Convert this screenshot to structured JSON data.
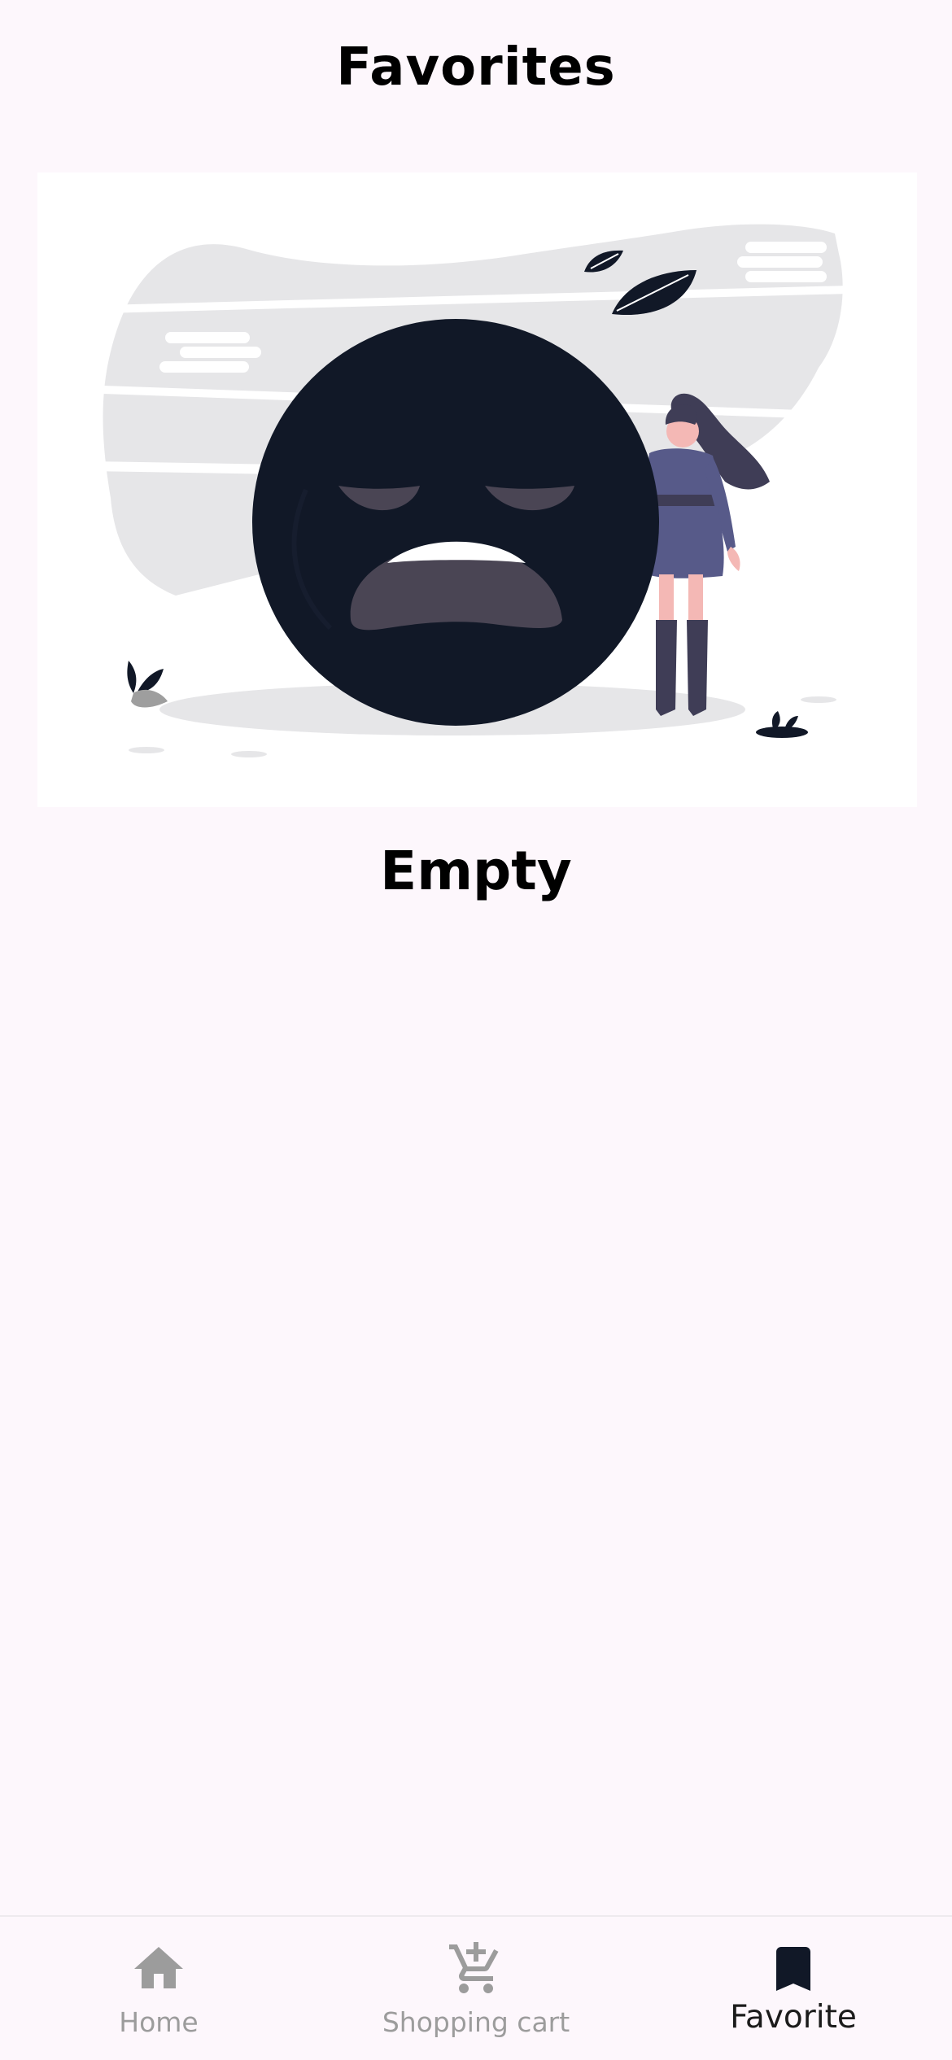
{
  "header": {
    "title": "Favorites"
  },
  "empty_state": {
    "illustration": "sad-face-woman-illustration",
    "message": "Empty"
  },
  "bottom_nav": {
    "items": [
      {
        "label": "Home",
        "icon": "home-icon",
        "active": false
      },
      {
        "label": "Shopping cart",
        "icon": "add-cart-icon",
        "active": false
      },
      {
        "label": "Favorite",
        "icon": "bookmark-icon",
        "active": true
      }
    ]
  },
  "colors": {
    "background": "#fdf7fc",
    "face": "#111827",
    "accent_purple": "#575a89",
    "inactive_nav": "#9c9c9c",
    "active_nav": "#111827"
  }
}
